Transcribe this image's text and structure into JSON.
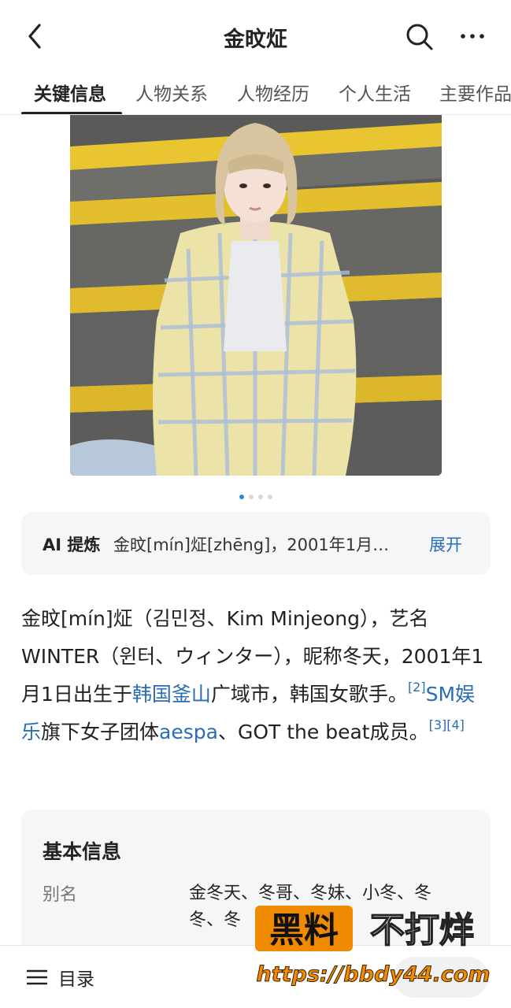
{
  "header": {
    "title": "金旼炡",
    "back_icon": "chevron-left-icon",
    "search_icon": "search-icon",
    "more_icon": "more-horizontal-icon"
  },
  "tabs": [
    {
      "label": "关键信息",
      "active": true
    },
    {
      "label": "人物关系",
      "active": false
    },
    {
      "label": "人物经历",
      "active": false
    },
    {
      "label": "个人生活",
      "active": false
    },
    {
      "label": "主要作品",
      "active": false
    }
  ],
  "carousel": {
    "count": 4,
    "current": 1
  },
  "ai_summary": {
    "label": "AI 提炼",
    "text": "金旼[mín]炡[zhēng]，2001年1月…",
    "expand": "展开"
  },
  "summary": {
    "p1": "金旼[mín]炡（김민정、Kim Minjeong），艺名WINTER（윈터、ウィンター），昵称冬天，2001年1月1日出生于",
    "link_busan": "韩国釜山",
    "p2": "广域市，韩国女歌手。",
    "ref2": "[2]",
    "link_sm": "SM娱乐",
    "p3": "旗下女子团体",
    "link_aespa": "aespa",
    "p4": "、GOT the beat成员。",
    "ref3": "[3]",
    "ref4": "[4]"
  },
  "basic_info": {
    "title": "基本信息",
    "rows": [
      {
        "key": "别名",
        "value": "金冬天、冬哥、冬妹、小冬、冬冬、冬"
      }
    ]
  },
  "bottom": {
    "toc_label": "目录",
    "toc_icon": "menu-icon"
  },
  "watermark": {
    "line1a": "黑料",
    "line1b": "不打烊",
    "url": "https://bbdy44.com"
  },
  "colors": {
    "link": "#2a6cb5",
    "accent_dot": "#2d8cd9",
    "card_bg": "#f5f6f7",
    "watermark_orange": "#f08a00"
  }
}
